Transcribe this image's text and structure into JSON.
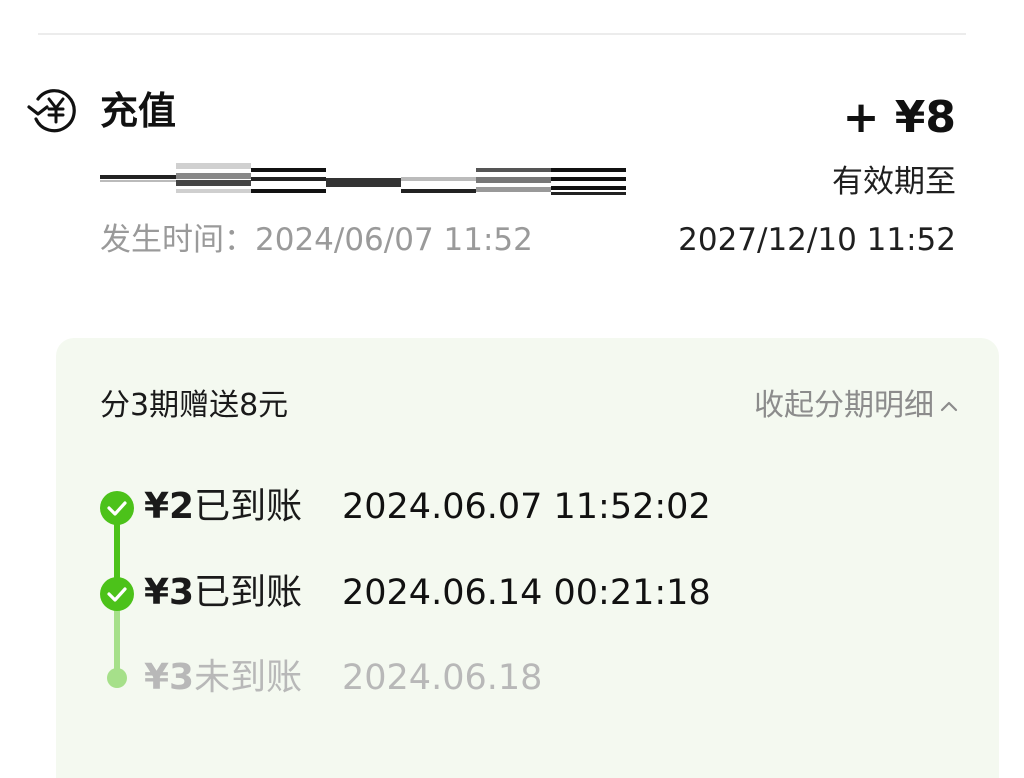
{
  "transaction": {
    "icon": "yen-exchange-icon",
    "title": "充值",
    "amount": "+ ¥8",
    "expiry_label": "有效期至",
    "occurred_label": "发生时间：",
    "occurred_time": "2024/06/07 11:52",
    "expiry_date": "2027/12/10 11:52"
  },
  "installments": {
    "title": "分3期赠送8元",
    "collapse_label": "收起分期明细",
    "accent_color": "#4cc21a",
    "items": [
      {
        "amount": "¥2",
        "status": "已到账",
        "date": "2024.06.07 11:52:02",
        "done": true
      },
      {
        "amount": "¥3",
        "status": "已到账",
        "date": "2024.06.14 00:21:18",
        "done": true
      },
      {
        "amount": "¥3",
        "status": "未到账",
        "date": "2024.06.18",
        "done": false
      }
    ]
  }
}
